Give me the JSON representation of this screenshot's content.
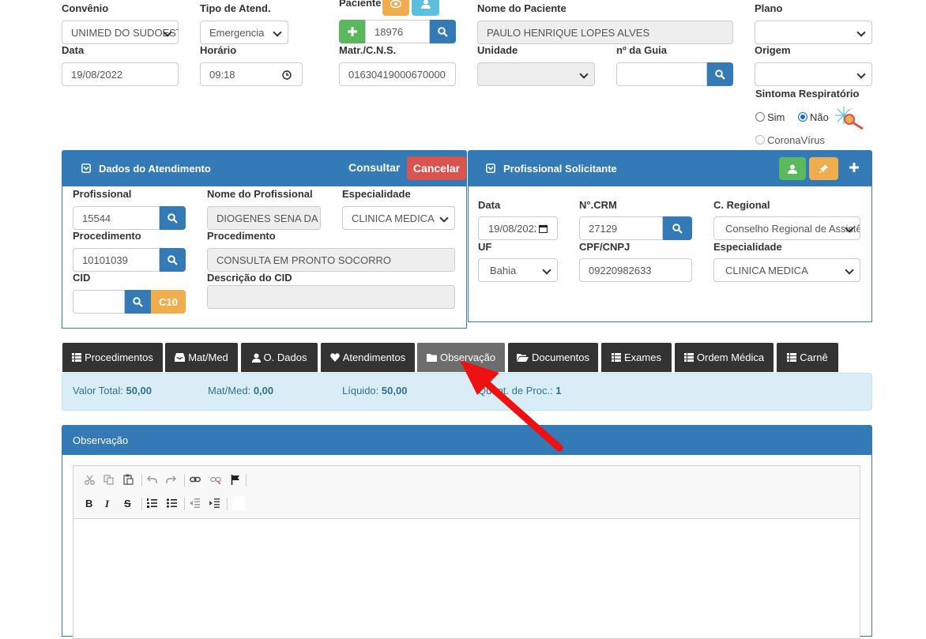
{
  "colors": {
    "primary": "#337ab7",
    "success": "#5cb85c",
    "warning": "#f0ad4e",
    "info": "#5bc0de",
    "danger": "#d9534f",
    "tab_dark": "#333333",
    "tab_active": "#6d6d6d",
    "summary_bg": "#d9edf7"
  },
  "top": {
    "convenio": {
      "label": "Convênio",
      "value": "UNIMED DO SUDOESTE"
    },
    "tipo": {
      "label": "Tipo de Atend.",
      "value": "Emergencia"
    },
    "paciente": {
      "label": "Paciente",
      "value": "18976"
    },
    "nome_paciente": {
      "label": "Nome do Paciente",
      "value": "PAULO HENRIQUE LOPES ALVES"
    },
    "plano": {
      "label": "Plano",
      "value": ""
    },
    "data": {
      "label": "Data",
      "value": "19/08/2022"
    },
    "horario": {
      "label": "Horário",
      "value": "09:18"
    },
    "matr": {
      "label": "Matr./C.N.S.",
      "value": "01630419000670000"
    },
    "unidade": {
      "label": "Unidade",
      "value": ""
    },
    "guia": {
      "label": "nº da Guia",
      "value": ""
    },
    "origem": {
      "label": "Origem",
      "value": ""
    },
    "sintoma": {
      "label": "Sintoma Respiratório",
      "sim": "Sim",
      "nao": "Não",
      "corona": "CoronaVírus",
      "selected": "Não"
    }
  },
  "atendimento": {
    "title": "Dados do Atendimento",
    "consultar": "Consultar",
    "cancelar": "Cancelar",
    "profissional": {
      "label": "Profissional",
      "value": "15544"
    },
    "nome_profissional": {
      "label": "Nome do Profissional",
      "value": "DIOGENES SENA DA SILVA"
    },
    "especialidade": {
      "label": "Especialidade",
      "value": "CLINICA MEDICA"
    },
    "procedimento": {
      "label": "Procedimento",
      "value": "10101039"
    },
    "procedimento_desc": {
      "label": "Procedimento",
      "value": "CONSULTA EM PRONTO SOCORRO"
    },
    "cid": {
      "label": "CID",
      "value": "",
      "badge": "C10"
    },
    "descricao_cid": {
      "label": "Descrição do CID",
      "value": ""
    }
  },
  "solicitante": {
    "title": "Profissional Solicitante",
    "data": {
      "label": "Data",
      "value": "19/08/2022"
    },
    "crm": {
      "label": "N°.CRM",
      "value": "27129"
    },
    "regional": {
      "label": "C. Regional",
      "value": "Conselho Regional de Assistência Social"
    },
    "uf": {
      "label": "UF",
      "value": "Bahia"
    },
    "cpf": {
      "label": "CPF/CNPJ",
      "value": "09220982633"
    },
    "especialidade": {
      "label": "Especialidade",
      "value": "CLINICA MEDICA"
    }
  },
  "tabs": [
    {
      "label": "Procedimentos",
      "icon": "list-icon"
    },
    {
      "label": "Mat/Med",
      "icon": "inbox-icon"
    },
    {
      "label": "O. Dados",
      "icon": "user-icon"
    },
    {
      "label": "Atendimentos",
      "icon": "heart-icon"
    },
    {
      "label": "Observação",
      "icon": "folder-icon"
    },
    {
      "label": "Documentos",
      "icon": "folder-open-icon"
    },
    {
      "label": "Exames",
      "icon": "list-icon"
    },
    {
      "label": "Ordem Médica",
      "icon": "list-icon"
    },
    {
      "label": "Carnê",
      "icon": "list-icon"
    }
  ],
  "active_tab": "Observação",
  "summary": {
    "valor_total_label": "Valor Total:",
    "valor_total": "50,00",
    "matmed_label": "Mat/Med:",
    "matmed": "0,00",
    "liquido_label": "Líquido:",
    "liquido": "50,00",
    "quant_label": "Quant. de Proc.:",
    "quant": "1"
  },
  "observacao": {
    "title": "Observação"
  }
}
